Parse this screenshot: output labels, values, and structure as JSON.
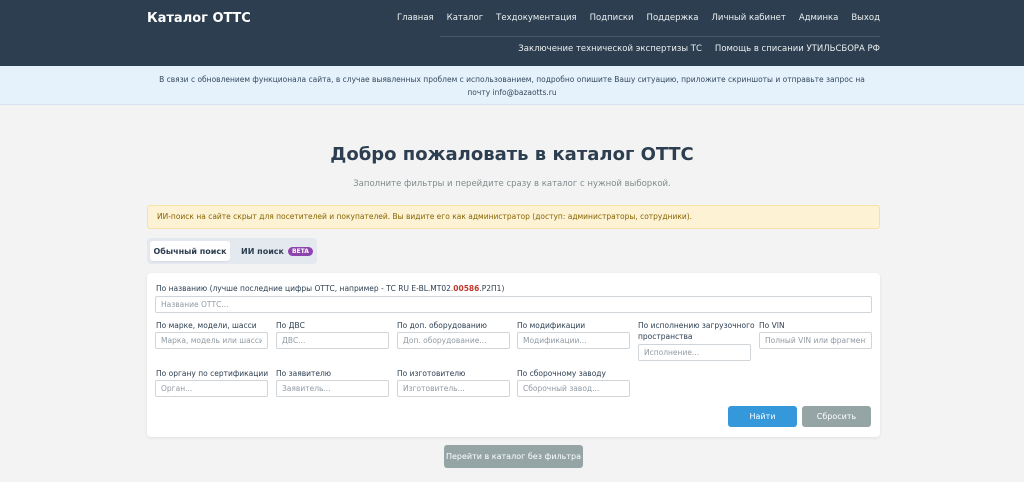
{
  "header": {
    "brand": "Каталог ОТТС",
    "nav_primary": [
      "Главная",
      "Каталог",
      "Техдокументация",
      "Подписки",
      "Поддержка",
      "Личный кабинет",
      "Админка",
      "Выход"
    ],
    "nav_secondary": [
      "Заключение технической экспертизы ТС",
      "Помощь в списании УТИЛЬСБОРА РФ"
    ],
    "bg_color": "#2c3e50"
  },
  "notice": {
    "text": "В связи с обновлением функционала сайта, в случае выявленных проблем с использованием, подробно опишите Вашу ситуацию, приложите скриншоты и отправьте запрос на почту info@bazaotts.ru"
  },
  "main": {
    "title": "Добро пожаловать в каталог ОТТС",
    "subtitle": "Заполните фильтры и перейдите сразу в каталог с нужной выборкой.",
    "alert": "ИИ-поиск на сайте скрыт для посетителей и покупателей. Вы видите его как администратор (доступ: администраторы, сотрудники).",
    "tabs": {
      "normal": "Обычный поиск",
      "ai": "ИИ поиск",
      "ai_badge": "BETA"
    }
  },
  "form": {
    "name_label_prefix": "По названию (лучше последние цифры ОТТС, например - ТС RU E-BL.МТ02.",
    "name_label_highlight": "00586",
    "name_label_suffix": ".Р2П1)",
    "name_placeholder": "Название ОТТС...",
    "brand_label": "По марке, модели, шасси",
    "brand_placeholder": "Марка, модель или шасси —",
    "engine_label": "По ДВС",
    "engine_placeholder": "ДВС...",
    "equipment_label": "По доп. оборудованию",
    "equipment_placeholder": "Доп. оборудование...",
    "modification_label": "По модификации",
    "modification_placeholder": "Модификации...",
    "cargo_label_1": "По исполнению загрузочного",
    "cargo_label_2": "пространства",
    "cargo_placeholder": "Исполнение...",
    "vin_label": "По VIN",
    "vin_placeholder": "Полный VIN или фрагмент (с",
    "organ_label": "По органу по сертификации",
    "organ_placeholder": "Орган...",
    "applicant_label": "По заявителю",
    "applicant_placeholder": "Заявитель...",
    "manufacturer_label": "По изготовителю",
    "manufacturer_placeholder": "Изготовитель...",
    "plant_label": "По сборочному заводу",
    "plant_placeholder": "Сборочный завод...",
    "find_button": "Найти",
    "reset_button": "Сбросить"
  },
  "catalog_button": "Перейти в каталог без фильтра",
  "colors": {
    "primary": "#3498db",
    "secondary": "#95a5a6",
    "alert_bg": "#fdf3d4",
    "badge": "#8e44ad"
  }
}
